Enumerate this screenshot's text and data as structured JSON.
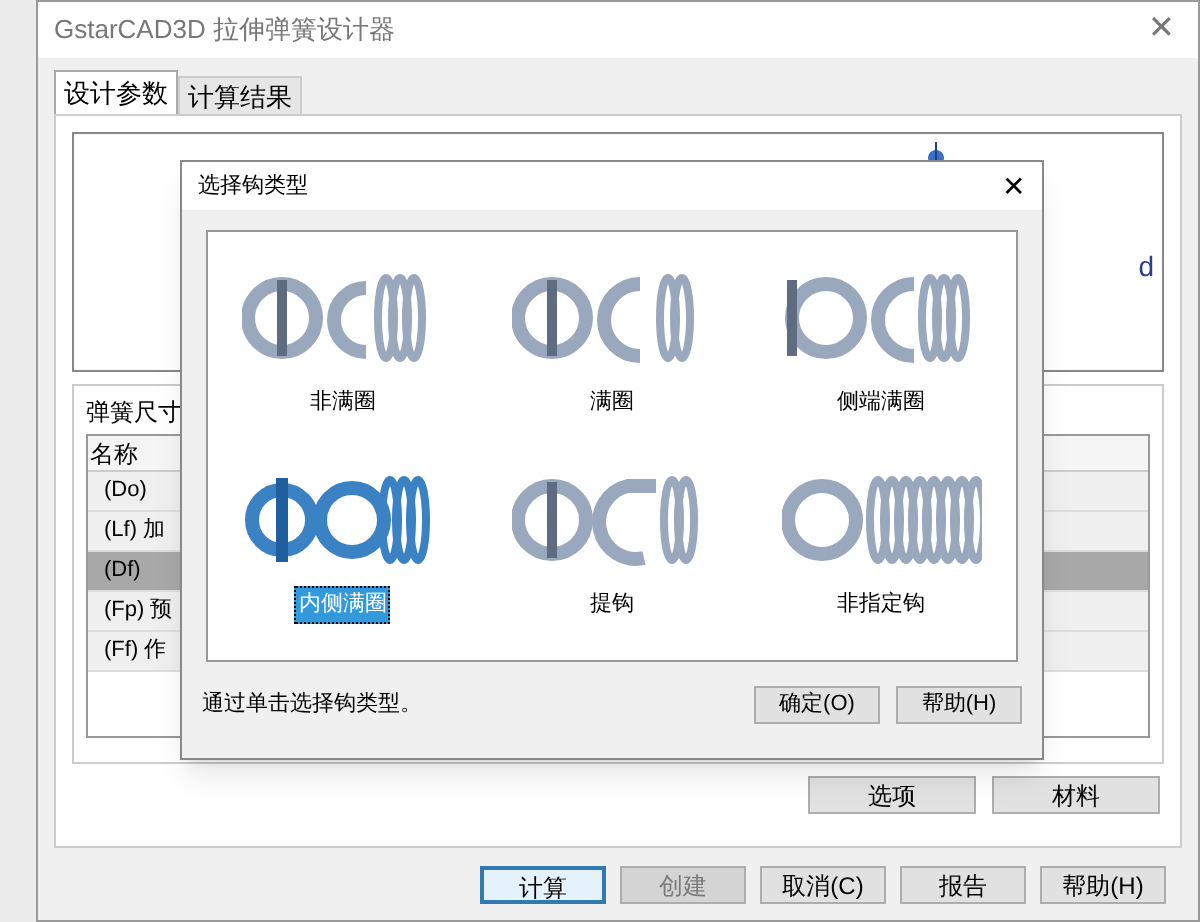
{
  "window": {
    "title": "GstarCAD3D 拉伸弹簧设计器",
    "close": "✕"
  },
  "tabs": [
    {
      "label": "设计参数",
      "selected": true
    },
    {
      "label": "计算结果",
      "selected": false
    }
  ],
  "preview": {
    "label": "d"
  },
  "dimensions": {
    "title": "弹簧尺寸",
    "column_1": "名称",
    "rows": [
      {
        "name": "(Do)",
        "selected": false
      },
      {
        "name": "(Lf) 加",
        "selected": false
      },
      {
        "name": "(Df)",
        "selected": true
      },
      {
        "name": "(Fp) 预",
        "selected": false
      },
      {
        "name": "(Ff) 作",
        "selected": false
      }
    ]
  },
  "side_buttons": [
    {
      "label": "选项",
      "disabled": false
    },
    {
      "label": "材料",
      "disabled": false
    }
  ],
  "buttons": [
    {
      "label": "计算",
      "disabled": false,
      "default": true
    },
    {
      "label": "创建",
      "disabled": true,
      "default": false
    },
    {
      "label": "取消(C)",
      "disabled": false,
      "default": false
    },
    {
      "label": "报告",
      "disabled": false,
      "default": false
    },
    {
      "label": "帮助(H)",
      "disabled": false,
      "default": false
    }
  ],
  "dialog": {
    "title": "选择钩类型",
    "close": "✕",
    "hooks": [
      {
        "label": "非满圈",
        "kind": "partial",
        "selected": false
      },
      {
        "label": "满圈",
        "kind": "full",
        "selected": false
      },
      {
        "label": "侧端满圈",
        "kind": "side",
        "selected": false
      },
      {
        "label": "内侧满圈",
        "kind": "inner",
        "selected": true
      },
      {
        "label": "提钩",
        "kind": "lift",
        "selected": false
      },
      {
        "label": "非指定钩",
        "kind": "unspecified",
        "selected": false
      }
    ],
    "hint": "通过单击选择钩类型。",
    "buttons": [
      "确定(O)",
      "帮助(H)"
    ]
  }
}
